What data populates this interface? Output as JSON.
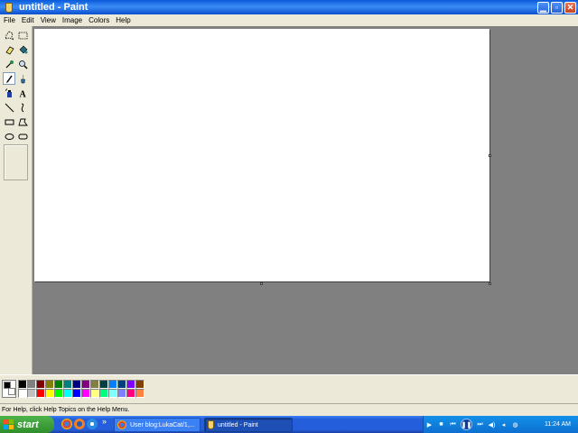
{
  "window": {
    "title": "untitled - Paint",
    "minimize_symbol": "▁",
    "maximize_symbol": "▫",
    "close_symbol": "✕"
  },
  "menu": [
    "File",
    "Edit",
    "View",
    "Image",
    "Colors",
    "Help"
  ],
  "tools": [
    {
      "name": "free-form-select-icon",
      "label": "Free-Form Select"
    },
    {
      "name": "select-icon",
      "label": "Select"
    },
    {
      "name": "eraser-icon",
      "label": "Eraser"
    },
    {
      "name": "fill-bucket-icon",
      "label": "Fill With Color"
    },
    {
      "name": "color-picker-icon",
      "label": "Pick Color"
    },
    {
      "name": "magnifier-icon",
      "label": "Magnifier"
    },
    {
      "name": "pencil-icon",
      "label": "Pencil",
      "active": true
    },
    {
      "name": "brush-icon",
      "label": "Brush"
    },
    {
      "name": "airbrush-icon",
      "label": "Airbrush"
    },
    {
      "name": "text-icon",
      "label": "Text"
    },
    {
      "name": "line-icon",
      "label": "Line"
    },
    {
      "name": "curve-icon",
      "label": "Curve"
    },
    {
      "name": "rectangle-icon",
      "label": "Rectangle"
    },
    {
      "name": "polygon-icon",
      "label": "Polygon"
    },
    {
      "name": "ellipse-icon",
      "label": "Ellipse"
    },
    {
      "name": "rounded-rectangle-icon",
      "label": "Rounded Rectangle"
    }
  ],
  "colors": {
    "foreground": "#000000",
    "background": "#ffffff",
    "palette_top": [
      "#000000",
      "#808080",
      "#800000",
      "#808000",
      "#008000",
      "#008080",
      "#000080",
      "#800080",
      "#808040",
      "#004040",
      "#0080ff",
      "#004080",
      "#8000ff",
      "#804000"
    ],
    "palette_bottom": [
      "#ffffff",
      "#c0c0c0",
      "#ff0000",
      "#ffff00",
      "#00ff00",
      "#00ffff",
      "#0000ff",
      "#ff00ff",
      "#ffff80",
      "#00ff80",
      "#80ffff",
      "#8080ff",
      "#ff0080",
      "#ff8040"
    ]
  },
  "status": {
    "help_text": "For Help, click Help Topics on the Help Menu."
  },
  "taskbar": {
    "start_label": "start",
    "quicklaunch_more": "»",
    "tasks": [
      {
        "label": "User blog:LukaCat/1,...",
        "icon": "chrome-icon",
        "active": false
      },
      {
        "label": "untitled - Paint",
        "icon": "paint-icon",
        "active": true
      }
    ],
    "clock": "11:24 AM"
  }
}
